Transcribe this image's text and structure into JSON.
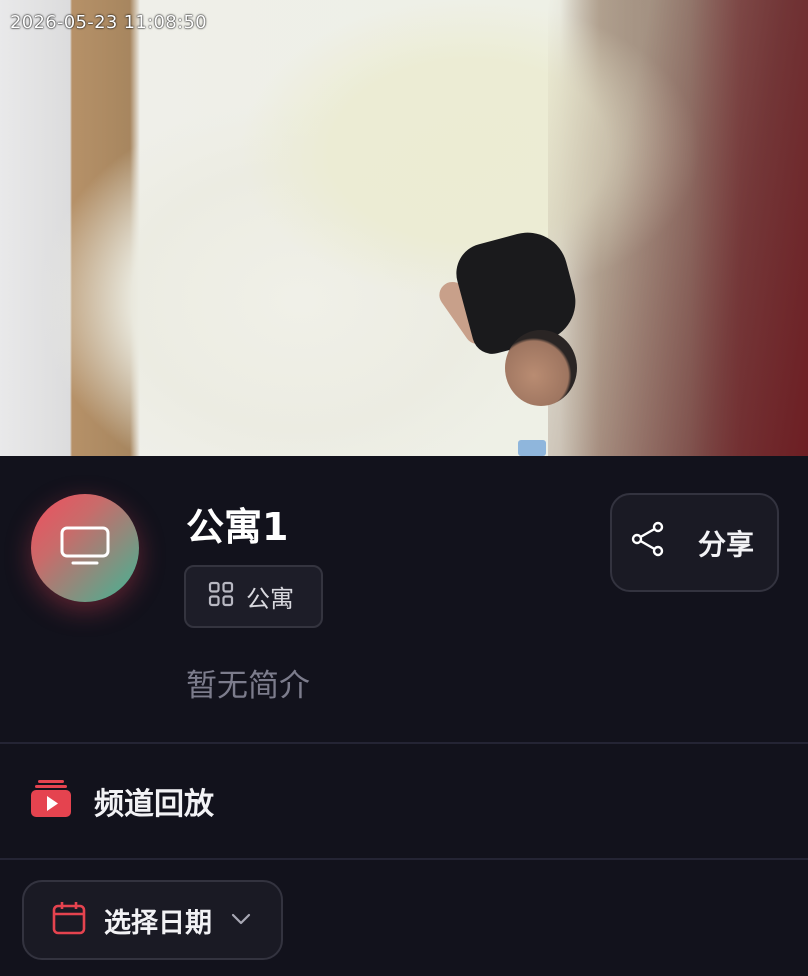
{
  "video": {
    "timestamp": "2026-05-23 11:08:50"
  },
  "channel": {
    "name": "公寓1",
    "category_tag": "公寓",
    "description": "暂无简介",
    "avatar_icon": "tv-icon",
    "tag_icon": "grid-icon"
  },
  "actions": {
    "share_label": "分享",
    "share_icon": "share-icon"
  },
  "playback": {
    "section_title": "频道回放",
    "section_icon": "playlist-play-icon",
    "date_picker_label": "选择日期",
    "date_picker_icon": "calendar-icon",
    "dropdown_icon": "chevron-down-icon"
  },
  "colors": {
    "accent_red": "#e5434f",
    "background": "#12121c",
    "card": "#1a1a24",
    "muted_text": "#7c7c8c"
  }
}
